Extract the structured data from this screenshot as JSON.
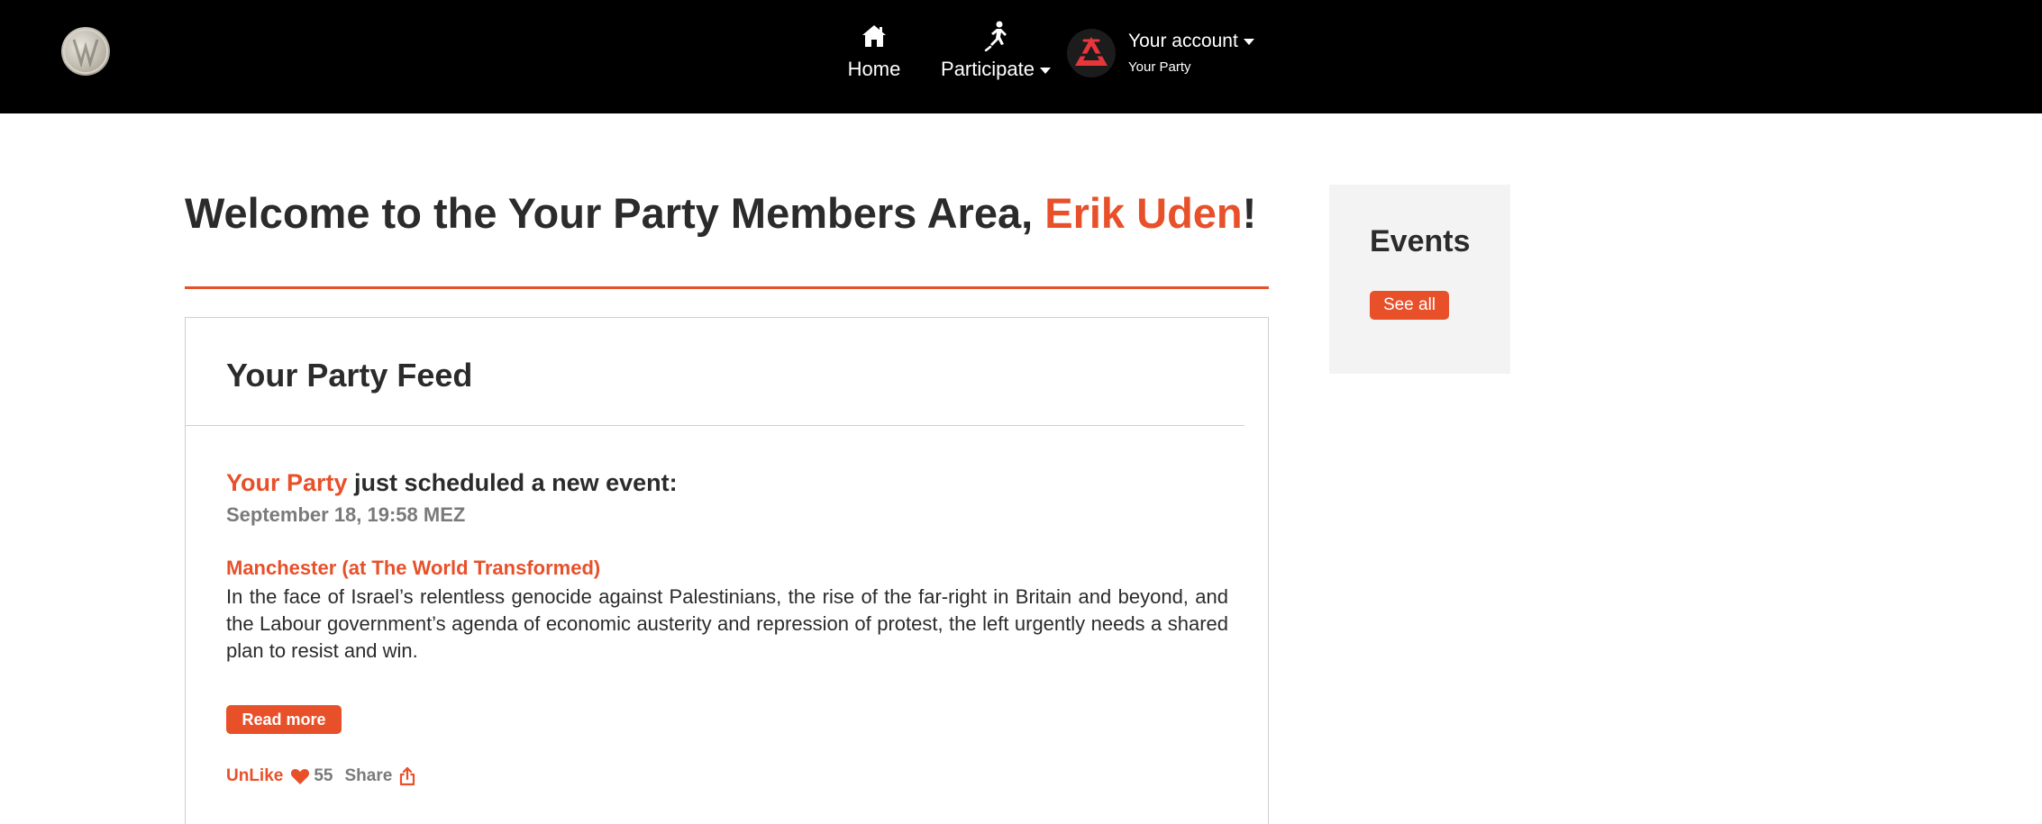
{
  "colors": {
    "accent": "#e8502a",
    "topbar": "#000000",
    "text": "#2b2b2b",
    "muted": "#7a7a7a",
    "sidebar_bg": "#f3f3f3"
  },
  "nav": {
    "logo_icon": "site-logo-icon",
    "home": {
      "label": "Home",
      "icon": "home-icon"
    },
    "participate": {
      "label": "Participate",
      "icon": "runner-icon"
    },
    "account": {
      "label": "Your account",
      "sub": "Your Party",
      "icon": "party-logo-icon"
    }
  },
  "welcome": {
    "prefix": "Welcome to the Your Party Members Area, ",
    "name": "Erik Uden",
    "suffix": "!"
  },
  "feed": {
    "title": "Your Party Feed",
    "post": {
      "org": "Your Party",
      "action": " just scheduled a new event:",
      "date": "September 18, 19:58 MEZ",
      "event_title": "Manchester (at The World Transformed)",
      "description": "In the face of Israel’s relentless genocide against Palestinians, the rise of the far-right in Britain and beyond, and the Labour government’s agenda of economic austerity and repression of protest, the left urgently needs a shared plan to resist and win.",
      "read_more": "Read more",
      "unlike": "UnLike",
      "likes": "55",
      "share": "Share"
    }
  },
  "events_panel": {
    "title": "Events",
    "see_all": "See all"
  }
}
